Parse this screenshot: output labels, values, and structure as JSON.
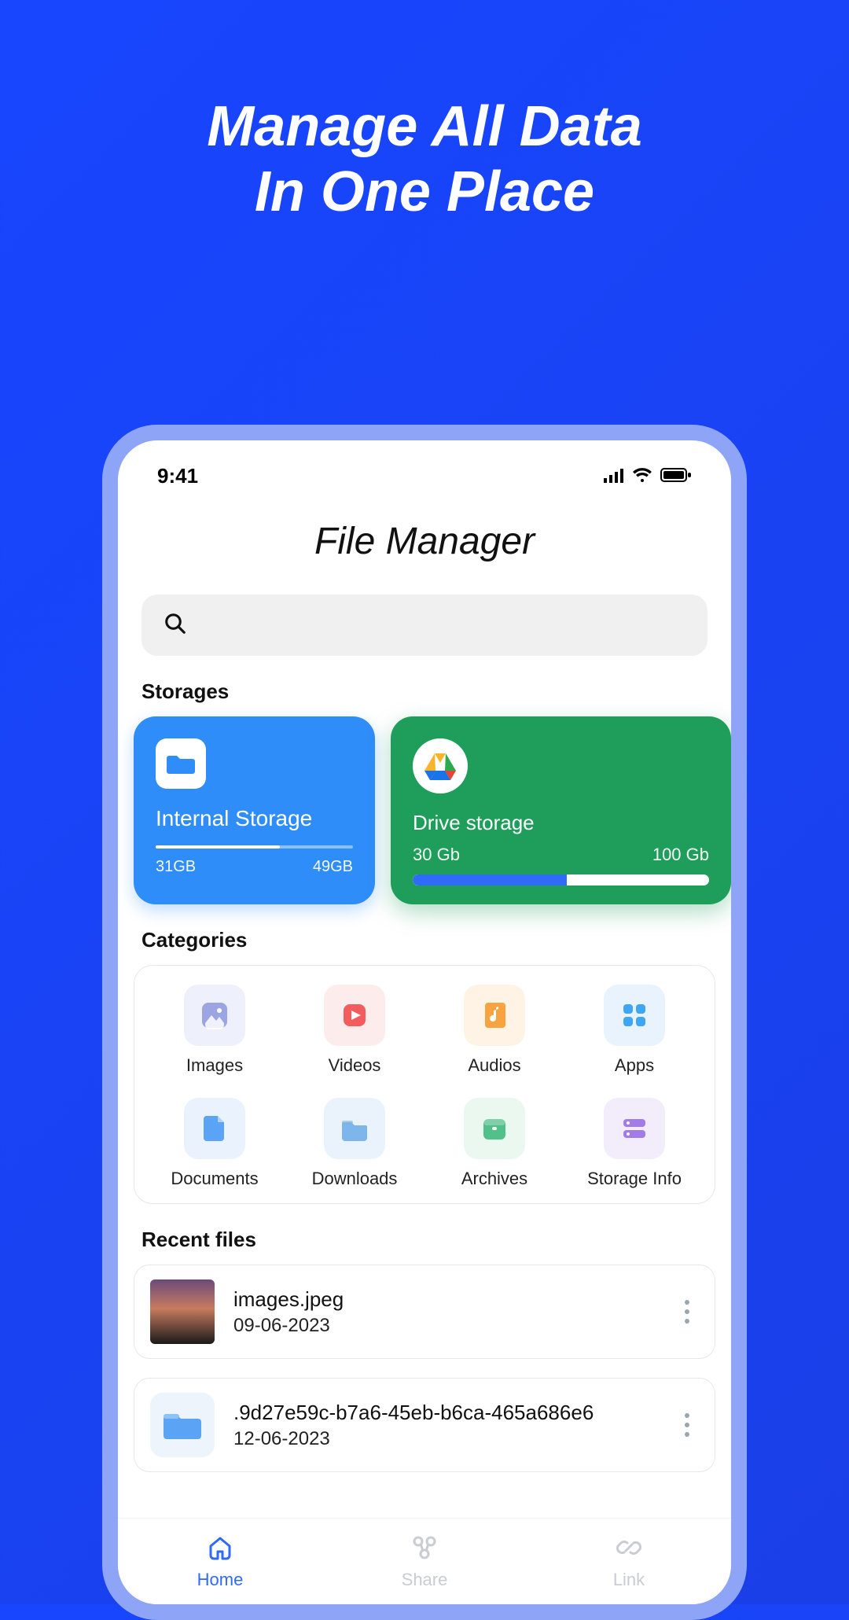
{
  "hero": {
    "line1": "Manage All Data",
    "line2": "In One Place"
  },
  "status_bar": {
    "time": "9:41"
  },
  "app": {
    "title": "File Manager"
  },
  "search": {
    "placeholder": ""
  },
  "sections": {
    "storages": "Storages",
    "categories": "Categories",
    "recent": "Recent files"
  },
  "storages": {
    "internal": {
      "name": "Internal Storage",
      "used": "31GB",
      "total": "49GB",
      "fill_pct": 63
    },
    "drive": {
      "name": "Drive storage",
      "used": "30 Gb",
      "total": "100 Gb",
      "fill_pct": 52
    }
  },
  "categories": [
    {
      "key": "images",
      "label": "Images",
      "bg": "#eef1fb",
      "icon_color": "#9aa5e2"
    },
    {
      "key": "videos",
      "label": "Videos",
      "bg": "#fdecec",
      "icon_color": "#f25c5c"
    },
    {
      "key": "audios",
      "label": "Audios",
      "bg": "#fff3e5",
      "icon_color": "#f7a33f"
    },
    {
      "key": "apps",
      "label": "Apps",
      "bg": "#e8f3fe",
      "icon_color": "#3fa6f5"
    },
    {
      "key": "documents",
      "label": "Documents",
      "bg": "#eaf2fe",
      "icon_color": "#5aa3f5"
    },
    {
      "key": "downloads",
      "label": "Downloads",
      "bg": "#eaf3fb",
      "icon_color": "#7cb6ea"
    },
    {
      "key": "archives",
      "label": "Archives",
      "bg": "#eaf8f0",
      "icon_color": "#52c08a"
    },
    {
      "key": "storage",
      "label": "Storage Info",
      "bg": "#f2ecfb",
      "icon_color": "#a37be8"
    }
  ],
  "recent": [
    {
      "name": "images.jpeg",
      "date": "09-06-2023",
      "thumb": "sunset"
    },
    {
      "name": ".9d27e59c-b7a6-45eb-b6ca-465a686e6",
      "date": "12-06-2023",
      "thumb": "folder"
    }
  ],
  "nav": [
    {
      "key": "home",
      "label": "Home",
      "active": true
    },
    {
      "key": "share",
      "label": "Share",
      "active": false
    },
    {
      "key": "link",
      "label": "Link",
      "active": false
    }
  ]
}
